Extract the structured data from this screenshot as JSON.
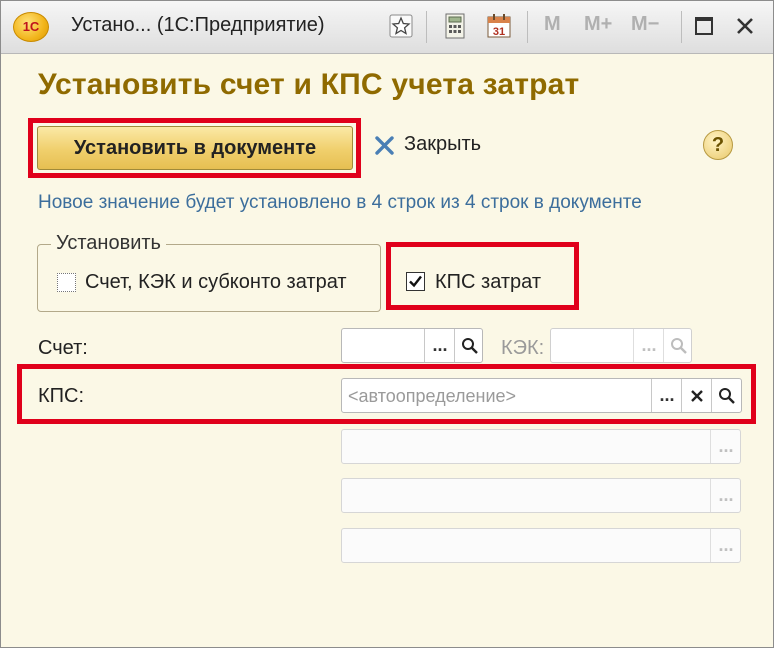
{
  "window": {
    "title": "Устано... (1С:Предприятие)",
    "logo_text": "1С",
    "toolbar_icons": [
      "star-icon",
      "calculator-icon",
      "calendar-icon"
    ],
    "calendar_day": "31",
    "memory_buttons": [
      "M",
      "M+",
      "M−"
    ]
  },
  "form": {
    "heading": "Установить счет и КПС учета затрат",
    "set_button_label": "Установить в документе",
    "close_label": "Закрыть",
    "help_label": "?",
    "info_text": "Новое значение будет установлено в 4 строк из 4 строк в документе"
  },
  "set_group": {
    "label": "Установить",
    "checkbox_account": {
      "label": "Счет, КЭК и субконто затрат",
      "checked": false
    },
    "checkbox_kps": {
      "label": "КПС затрат",
      "checked": true
    }
  },
  "fields": {
    "account_label": "Счет:",
    "kek_label": "КЭК:",
    "kps_label": "КПС:",
    "kps_placeholder": "<автоопределение>",
    "ellipsis": "..."
  },
  "colors": {
    "highlight": "#e0001b",
    "heading": "#8f6a00",
    "info_text": "#3c6e9c",
    "background": "#fbf8e6"
  }
}
